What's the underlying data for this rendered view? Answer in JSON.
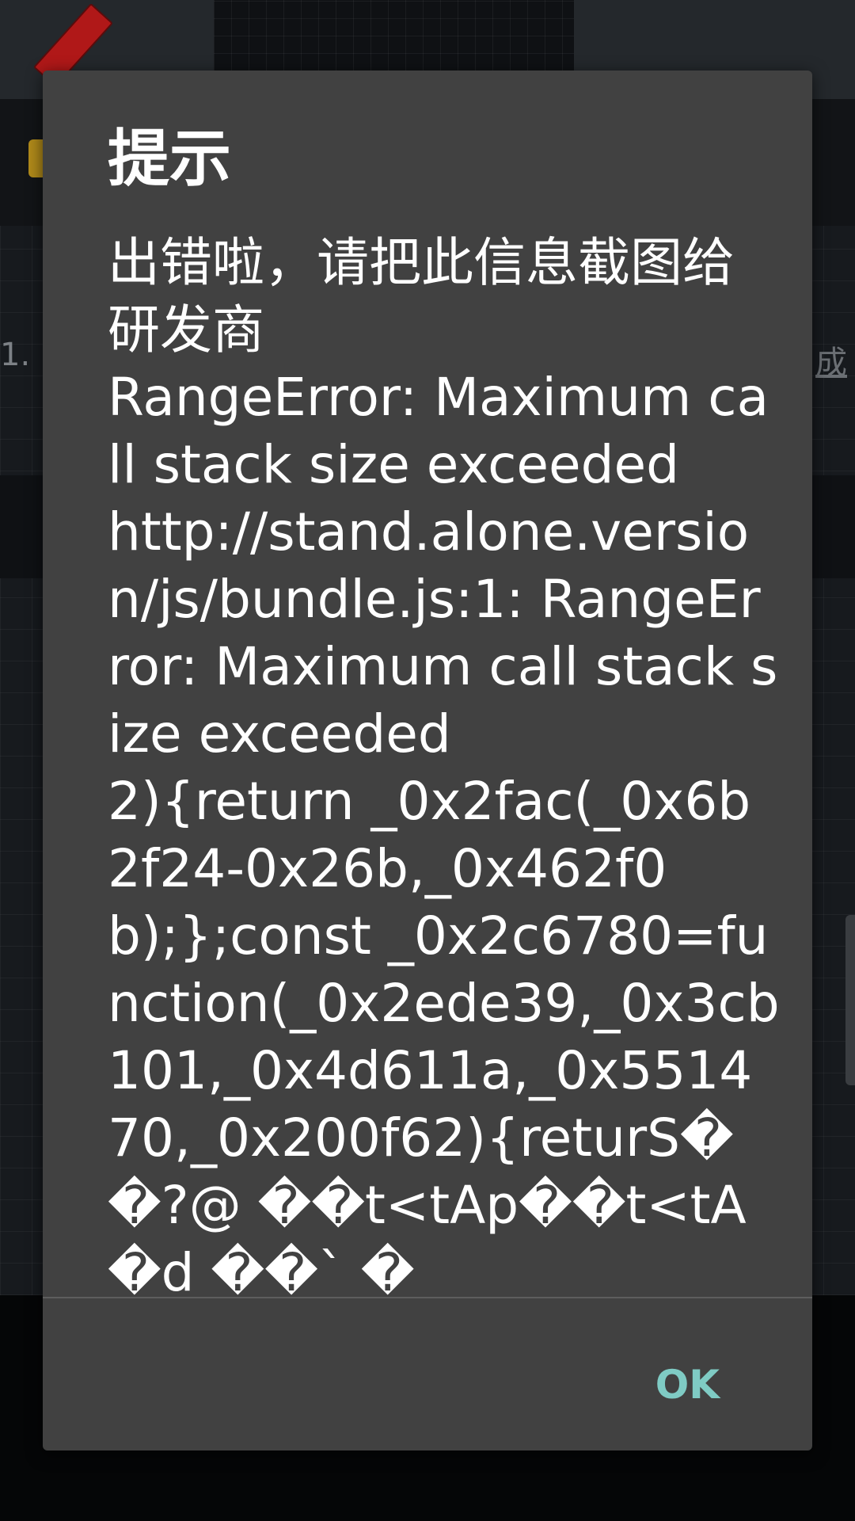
{
  "background": {
    "left_number": "1.",
    "right_character": "成"
  },
  "dialog": {
    "title": "提示",
    "message": "出错啦，请把此信息截图给研发商\nRangeError: Maximum call stack size exceeded\nhttp://stand.alone.version/js/bundle.js:1: RangeError: Maximum call stack size exceeded\n2){return _0x2fac(_0x6b2f24-0x26b,_0x462f0b);};const _0x2c6780=function(_0x2ede39,_0x3cb101,_0x4d611a,_0x551470,_0x200f62){returS��?@ ��t<tAp��t<tA�d ��` �",
    "ok_label": "OK"
  },
  "colors": {
    "dialog_background": "#414141",
    "accent": "#7fcbc4",
    "text": "#ffffff"
  }
}
